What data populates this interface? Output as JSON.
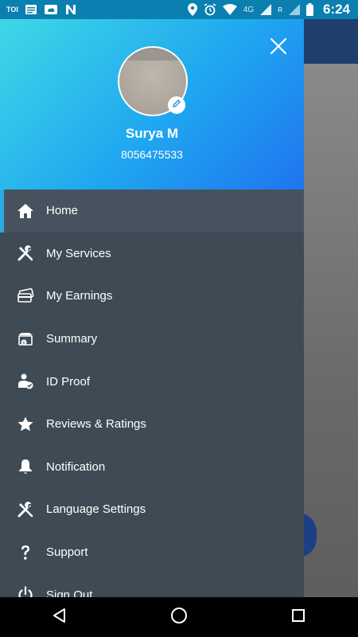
{
  "status_bar": {
    "carrier_label": "TOI",
    "network": "4G",
    "roaming": "R",
    "time": "6:24"
  },
  "drawer": {
    "user": {
      "name": "Surya M",
      "phone": "8056475533"
    },
    "menu": [
      {
        "label": "Home",
        "icon": "home-icon",
        "active": true
      },
      {
        "label": "My Services",
        "icon": "tools-icon",
        "active": false
      },
      {
        "label": "My Earnings",
        "icon": "cards-icon",
        "active": false
      },
      {
        "label": "Summary",
        "icon": "summary-icon",
        "active": false
      },
      {
        "label": "ID Proof",
        "icon": "id-proof-icon",
        "active": false
      },
      {
        "label": "Reviews & Ratings",
        "icon": "star-icon",
        "active": false
      },
      {
        "label": "Notification",
        "icon": "bell-icon",
        "active": false
      },
      {
        "label": "Language Settings",
        "icon": "tools-icon",
        "active": false
      },
      {
        "label": "Support",
        "icon": "question-icon",
        "active": false
      },
      {
        "label": "Sign Out",
        "icon": "power-icon",
        "active": false
      }
    ]
  },
  "colors": {
    "accent": "#2ca9e8",
    "drawer_bg": "#3e4b55",
    "header_gradient_start": "#3fd8e6",
    "header_gradient_end": "#1f74f0"
  }
}
